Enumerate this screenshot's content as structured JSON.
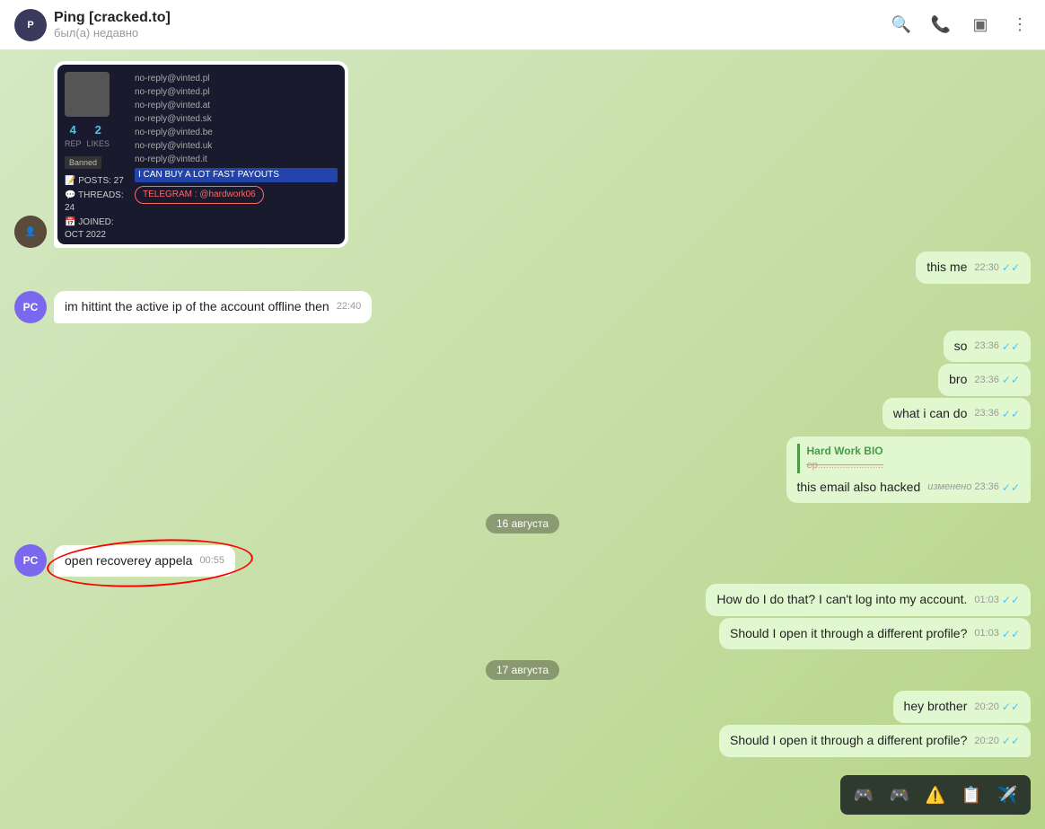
{
  "header": {
    "title": "Ping [cracked.to]",
    "status": "был(а) недавно",
    "avatar_initials": "P"
  },
  "messages": [
    {
      "id": "msg-screenshot",
      "type": "incoming",
      "has_avatar": true,
      "avatar_type": "dark",
      "avatar_initials": "",
      "content_type": "screenshot",
      "time": ""
    },
    {
      "id": "msg-this-me",
      "type": "outgoing",
      "text": "this me",
      "time": "22:30",
      "ticks": "double"
    },
    {
      "id": "msg-hitting",
      "type": "incoming",
      "has_avatar": true,
      "avatar_type": "purple",
      "avatar_initials": "PC",
      "text": "im hittint the active ip of the account offline then",
      "time": "22:40"
    },
    {
      "id": "msg-so",
      "type": "outgoing",
      "text": "so",
      "time": "23:36",
      "ticks": "double"
    },
    {
      "id": "msg-bro",
      "type": "outgoing",
      "text": "bro",
      "time": "23:36",
      "ticks": "double"
    },
    {
      "id": "msg-what-i-can-do",
      "type": "outgoing",
      "text": "what i can do",
      "time": "23:36",
      "ticks": "double"
    },
    {
      "id": "msg-hard-work",
      "type": "outgoing",
      "has_reply": true,
      "reply_title": "Hard Work BIO",
      "reply_text": "ep...",
      "text": "this email also hacked",
      "time": "23:36",
      "edited": true,
      "ticks": "double"
    }
  ],
  "date_separators": {
    "aug16": "16 августа",
    "aug17": "17 августа"
  },
  "messages2": [
    {
      "id": "msg-open-recovery",
      "type": "incoming",
      "has_avatar": true,
      "avatar_type": "purple",
      "avatar_initials": "PC",
      "text": "open recoverey appela",
      "time": "00:55",
      "has_red_circle": true
    },
    {
      "id": "msg-how-do",
      "type": "outgoing",
      "text": "How do I do that? I can't log into my account.",
      "time": "01:03",
      "ticks": "double"
    },
    {
      "id": "msg-should-open",
      "type": "outgoing",
      "text": "Should I open it through a different profile?",
      "time": "01:03",
      "ticks": "double"
    }
  ],
  "messages3": [
    {
      "id": "msg-hey-brother",
      "type": "outgoing",
      "text": "hey brother",
      "time": "20:20",
      "ticks": "double"
    },
    {
      "id": "msg-should-open2",
      "type": "outgoing",
      "text": "Should I open it through a different profile?",
      "time": "20:20",
      "ticks": "double"
    }
  ],
  "taskbar": {
    "icons": [
      "🎮",
      "🎮",
      "⚠️",
      "📋",
      "✈️"
    ]
  },
  "toolbar": {
    "search_icon": "🔍",
    "phone_icon": "📞",
    "layout_icon": "▣",
    "more_icon": "⋮"
  }
}
